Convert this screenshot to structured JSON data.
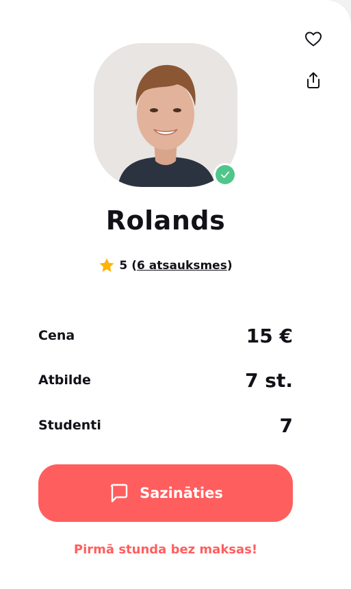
{
  "actions": {
    "favorite_icon": "heart-outline-icon",
    "share_icon": "share-upload-icon"
  },
  "tutor": {
    "name": "Rolands",
    "verified_icon": "check-icon",
    "rating_score": "5",
    "rating_open": "(",
    "reviews_link": "6 atsauksmes",
    "rating_close": ")"
  },
  "stats": [
    {
      "label": "Cena",
      "value": "15 €"
    },
    {
      "label": "Atbilde",
      "value": "7 st."
    },
    {
      "label": "Studenti",
      "value": "7"
    }
  ],
  "cta": {
    "label": "Sazināties",
    "icon": "chat-bubble-icon"
  },
  "promo": "Pirmā stunda bez maksas!",
  "colors": {
    "accent": "#ff5e5e",
    "verified": "#4fc68a",
    "star": "#ffb400",
    "text": "#121117"
  }
}
